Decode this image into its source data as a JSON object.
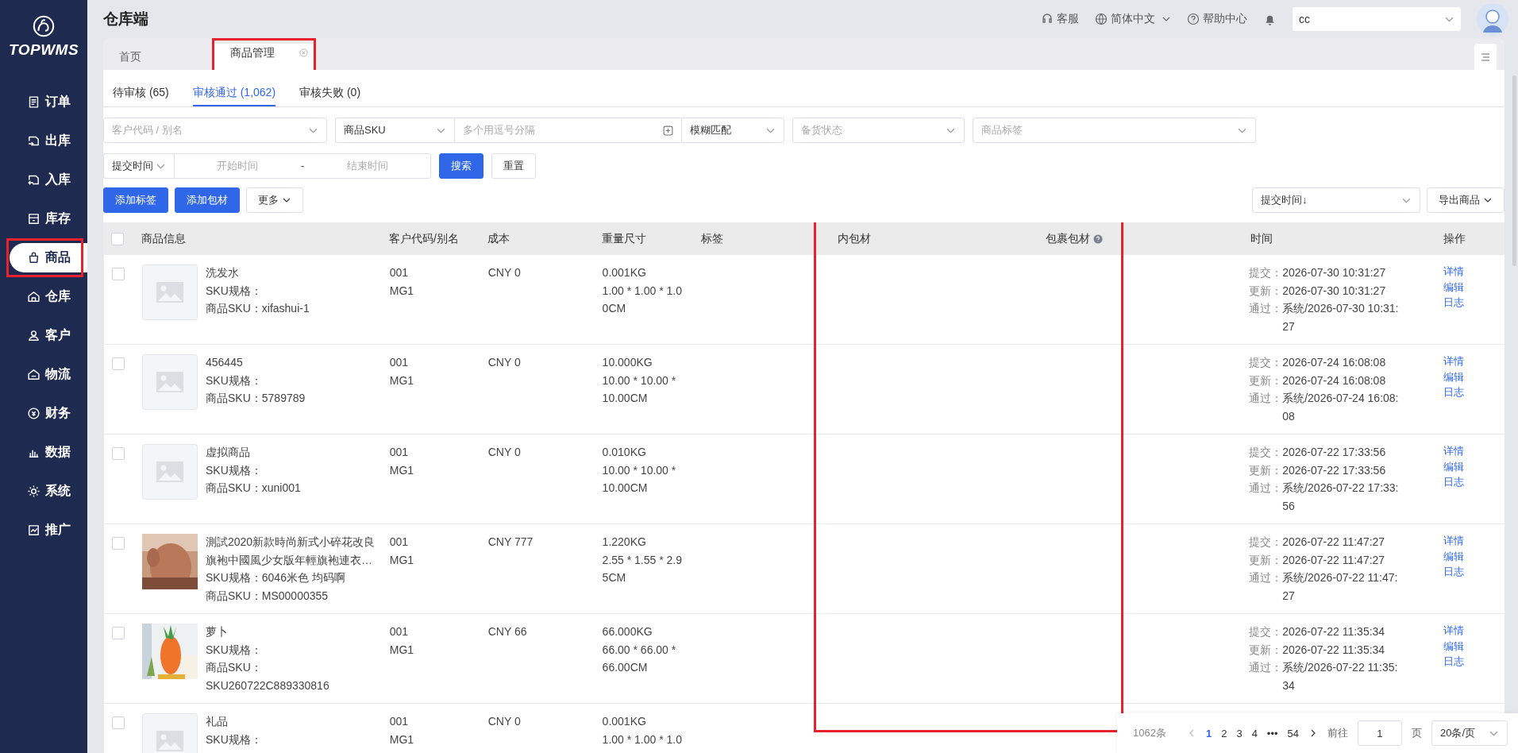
{
  "app": {
    "logo": "TOPWMS",
    "title": "仓库端"
  },
  "sidebar": {
    "items": [
      {
        "label": "订单",
        "selected": false,
        "highlighted": false
      },
      {
        "label": "出库",
        "selected": false,
        "highlighted": false
      },
      {
        "label": "入库",
        "selected": false,
        "highlighted": false
      },
      {
        "label": "库存",
        "selected": false,
        "highlighted": false
      },
      {
        "label": "商品",
        "selected": true,
        "highlighted": true
      },
      {
        "label": "仓库",
        "selected": false,
        "highlighted": false
      },
      {
        "label": "客户",
        "selected": false,
        "highlighted": false
      },
      {
        "label": "物流",
        "selected": false,
        "highlighted": false
      },
      {
        "label": "财务",
        "selected": false,
        "highlighted": false
      },
      {
        "label": "数据",
        "selected": false,
        "highlighted": false
      },
      {
        "label": "系统",
        "selected": false,
        "highlighted": false
      },
      {
        "label": "推广",
        "selected": false,
        "highlighted": false
      }
    ]
  },
  "header": {
    "service": "客服",
    "language": "简体中文",
    "help": "帮助中心",
    "account": "cc"
  },
  "page_tabs": [
    {
      "label": "首页",
      "selected": false,
      "closable": false,
      "highlighted": false
    },
    {
      "label": "商品管理",
      "selected": true,
      "closable": true,
      "highlighted": true
    }
  ],
  "review_tabs": [
    {
      "label": "待审核 (65)",
      "selected": false
    },
    {
      "label": "审核通过 (1,062)",
      "selected": true
    },
    {
      "label": "审核失败 (0)",
      "selected": false
    }
  ],
  "filters": {
    "customer": {
      "placeholder": "客户代码 / 别名"
    },
    "sku_type": "商品SKU",
    "sku_input": {
      "placeholder": "多个用逗号分隔"
    },
    "match": "模糊匹配",
    "stock_status": {
      "placeholder": "备货状态"
    },
    "tags": {
      "placeholder": "商品标签"
    },
    "time_type": "提交时间",
    "start": {
      "placeholder": "开始时间"
    },
    "separator": "-",
    "end": {
      "placeholder": "结束时间"
    },
    "search": "搜索",
    "reset": "重置"
  },
  "actions": {
    "add_tag": "添加标签",
    "add_package": "添加包材",
    "more": "更多",
    "sort": "提交时间↓",
    "export": "导出商品"
  },
  "table": {
    "select_all_checked": false,
    "packaging_highlighted": true,
    "columns": [
      {
        "label": "商品信息",
        "help": false
      },
      {
        "label": "客户代码/别名",
        "help": false
      },
      {
        "label": "成本",
        "help": false
      },
      {
        "label": "重量尺寸",
        "help": false
      },
      {
        "label": "标签",
        "help": false
      },
      {
        "label": "内包材",
        "help": false
      },
      {
        "label": "包裹包材",
        "help": true
      },
      {
        "label": "时间",
        "help": false
      },
      {
        "label": "操作",
        "help": false
      }
    ],
    "rows": [
      {
        "checked": false,
        "kind": "placeholder",
        "name": "洗发水",
        "spec": "SKU规格：",
        "sku": "商品SKU：xifashui-1",
        "code": [
          "001",
          "MG1"
        ],
        "cost": "CNY 0",
        "weight": "0.001KG",
        "dims": "1.00 * 1.00 * 1.00CM",
        "times": [
          {
            "label": "提交：",
            "value": "2026-07-30 10:31:27"
          },
          {
            "label": "更新：",
            "value": "2026-07-30 10:31:27"
          },
          {
            "label": "通过：",
            "value": "系统/2026-07-30 10:31:27"
          }
        ],
        "ops": [
          "详情",
          "编辑",
          "日志"
        ]
      },
      {
        "checked": false,
        "kind": "placeholder",
        "name": "456445",
        "spec": "SKU规格：",
        "sku": "商品SKU：5789789",
        "code": [
          "001",
          "MG1"
        ],
        "cost": "CNY 0",
        "weight": "10.000KG",
        "dims": "10.00 * 10.00 * 10.00CM",
        "times": [
          {
            "label": "提交：",
            "value": "2026-07-24 16:08:08"
          },
          {
            "label": "更新：",
            "value": "2026-07-24 16:08:08"
          },
          {
            "label": "通过：",
            "value": "系统/2026-07-24 16:08:08"
          }
        ],
        "ops": [
          "详情",
          "编辑",
          "日志"
        ]
      },
      {
        "checked": false,
        "kind": "placeholder",
        "name": "虚拟商品",
        "spec": "SKU规格：",
        "sku": "商品SKU：xuni001",
        "code": [
          "001",
          "MG1"
        ],
        "cost": "CNY 0",
        "weight": "0.010KG",
        "dims": "10.00 * 10.00 * 10.00CM",
        "times": [
          {
            "label": "提交：",
            "value": "2026-07-22 17:33:56"
          },
          {
            "label": "更新：",
            "value": "2026-07-22 17:33:56"
          },
          {
            "label": "通过：",
            "value": "系统/2026-07-22 17:33:56"
          }
        ],
        "ops": [
          "详情",
          "编辑",
          "日志"
        ]
      },
      {
        "checked": false,
        "kind": "picture",
        "name": "測試2020新款時尚新式小碎花改良旗袍中國風少女版年輕旗袍連衣…",
        "spec": "SKU规格：6046米色 均码啊",
        "sku": "商品SKU：MS00000355",
        "code": [
          "001",
          "MG1"
        ],
        "cost": "CNY 777",
        "weight": "1.220KG",
        "dims": "2.55 * 1.55 * 2.95CM",
        "times": [
          {
            "label": "提交：",
            "value": "2026-07-22 11:47:27"
          },
          {
            "label": "更新：",
            "value": "2026-07-22 11:47:27"
          },
          {
            "label": "通过：",
            "value": "系统/2026-07-22 11:47:27"
          }
        ],
        "ops": [
          "详情",
          "编辑",
          "日志"
        ]
      },
      {
        "checked": false,
        "kind": "picture",
        "name": "萝卜",
        "spec": "SKU规格：",
        "sku": "商品SKU：SKU260722C889330816",
        "code": [
          "001",
          "MG1"
        ],
        "cost": "CNY 66",
        "weight": "66.000KG",
        "dims": "66.00 * 66.00 * 66.00CM",
        "times": [
          {
            "label": "提交：",
            "value": "2026-07-22 11:35:34"
          },
          {
            "label": "更新：",
            "value": "2026-07-22 11:35:34"
          },
          {
            "label": "通过：",
            "value": "系统/2026-07-22 11:35:34"
          }
        ],
        "ops": [
          "详情",
          "编辑",
          "日志"
        ]
      },
      {
        "checked": false,
        "kind": "placeholder",
        "name": "礼品",
        "spec": "SKU规格：",
        "code": [
          "001",
          "MG1"
        ],
        "cost": "CNY 0",
        "weight": "0.001KG",
        "dims": "1.00 * 1.00 * 1.0"
      }
    ]
  },
  "pagination": {
    "total": "1062条",
    "pages": [
      {
        "label": "1",
        "selected": true
      },
      {
        "label": "2",
        "selected": false
      },
      {
        "label": "3",
        "selected": false
      },
      {
        "label": "4",
        "selected": false
      },
      {
        "label": "•••",
        "selected": false
      },
      {
        "label": "54",
        "selected": false
      }
    ],
    "goto": "前往",
    "page_value": "1",
    "page_unit": "页",
    "page_size": "20条/页"
  }
}
